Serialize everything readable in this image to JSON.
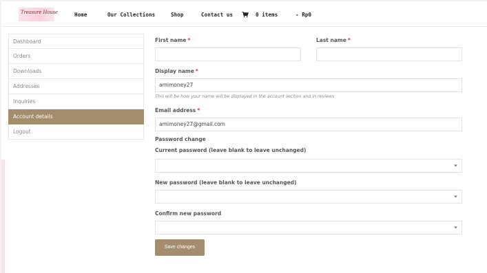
{
  "header": {
    "logo_text": "Treasure House",
    "nav": {
      "home": "Home",
      "collections": "Our Collections",
      "shop": "Shop",
      "contact": "Contact us",
      "cart_count": "0 items",
      "cart_total": "- Rp0"
    }
  },
  "sidebar": {
    "items": [
      {
        "label": "Dashboard"
      },
      {
        "label": "Orders"
      },
      {
        "label": "Downloads"
      },
      {
        "label": "Addresses"
      },
      {
        "label": "Inquiries"
      },
      {
        "label": "Account details"
      },
      {
        "label": "Logout"
      }
    ]
  },
  "form": {
    "first_name_label": "First name",
    "last_name_label": "Last name",
    "display_name_label": "Display name",
    "display_name_value": "amimoney27",
    "display_name_hint": "This will be how your name will be displayed in the account section and in reviews",
    "email_label": "Email address",
    "email_value": "amimoney27@gmail.com",
    "required_marker": "*",
    "password_section": "Password change",
    "current_password_label": "Current password (leave blank to leave unchanged)",
    "new_password_label": "New password (leave blank to leave unchanged)",
    "confirm_password_label": "Confirm new password",
    "save_label": "Save changes"
  },
  "colors": {
    "accent": "#a38d6c",
    "required": "#dd3333",
    "logo_background": "#f7d2dc"
  },
  "icons": {
    "cart": "cart-icon",
    "password_toggle": "eye-icon"
  }
}
